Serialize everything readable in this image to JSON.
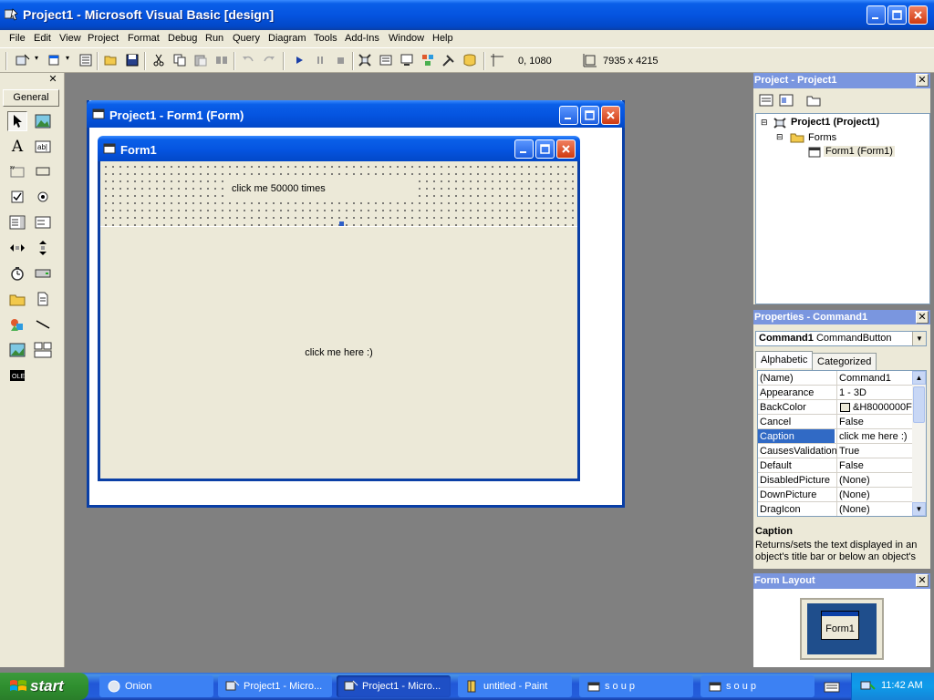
{
  "window": {
    "title": "Project1 - Microsoft Visual Basic [design]"
  },
  "menu": [
    "File",
    "Edit",
    "View",
    "Project",
    "Format",
    "Debug",
    "Run",
    "Query",
    "Diagram",
    "Tools",
    "Add-Ins",
    "Window",
    "Help"
  ],
  "toolbar": {
    "position": "0, 1080",
    "size": "7935 x 4215"
  },
  "toolbox": {
    "tab_label": "General",
    "tools": [
      "pointer",
      "picturebox",
      "label",
      "textbox",
      "frame",
      "commandbutton",
      "checkbox",
      "optionbutton",
      "combobox",
      "listbox",
      "hscrollbar",
      "vscrollbar",
      "timer",
      "drivelistbox",
      "dirlistbox",
      "filelistbox",
      "shape",
      "line",
      "image",
      "data",
      "ole"
    ]
  },
  "designer": {
    "title": "Project1 - Form1 (Form)",
    "form_caption": "Form1",
    "label1_caption": "click me 50000 times",
    "command1_caption": "click me here :)"
  },
  "project_panel": {
    "title": "Project - Project1",
    "root": "Project1 (Project1)",
    "folder": "Forms",
    "item": "Form1 (Form1)"
  },
  "properties_panel": {
    "title": "Properties - Command1",
    "object_name": "Command1",
    "object_type": "CommandButton",
    "tabs": [
      "Alphabetic",
      "Categorized"
    ],
    "rows": [
      {
        "name": "(Name)",
        "value": "Command1"
      },
      {
        "name": "Appearance",
        "value": "1 - 3D"
      },
      {
        "name": "BackColor",
        "value": "&H8000000F"
      },
      {
        "name": "Cancel",
        "value": "False"
      },
      {
        "name": "Caption",
        "value": "click me here :)"
      },
      {
        "name": "CausesValidation",
        "value": "True"
      },
      {
        "name": "Default",
        "value": "False"
      },
      {
        "name": "DisabledPicture",
        "value": "(None)"
      },
      {
        "name": "DownPicture",
        "value": "(None)"
      },
      {
        "name": "DragIcon",
        "value": "(None)"
      }
    ],
    "selected_row": "Caption",
    "desc_title": "Caption",
    "desc_text": "Returns/sets the text displayed in an object's title bar or below an object's"
  },
  "form_layout": {
    "title": "Form Layout",
    "preview_label": "Form1"
  },
  "taskbar": {
    "start_label": "start",
    "tasks": [
      "Onion",
      "Project1 - Micro...",
      "Project1 - Micro...",
      "untitled - Paint",
      "s o u p",
      "s o u p"
    ],
    "active_task_index": 2,
    "clock": "11:42 AM"
  },
  "colors": {
    "xp_blue": "#0554e0",
    "face": "#ece9d8",
    "mdi_gray": "#808080",
    "selection": "#316ac5"
  }
}
